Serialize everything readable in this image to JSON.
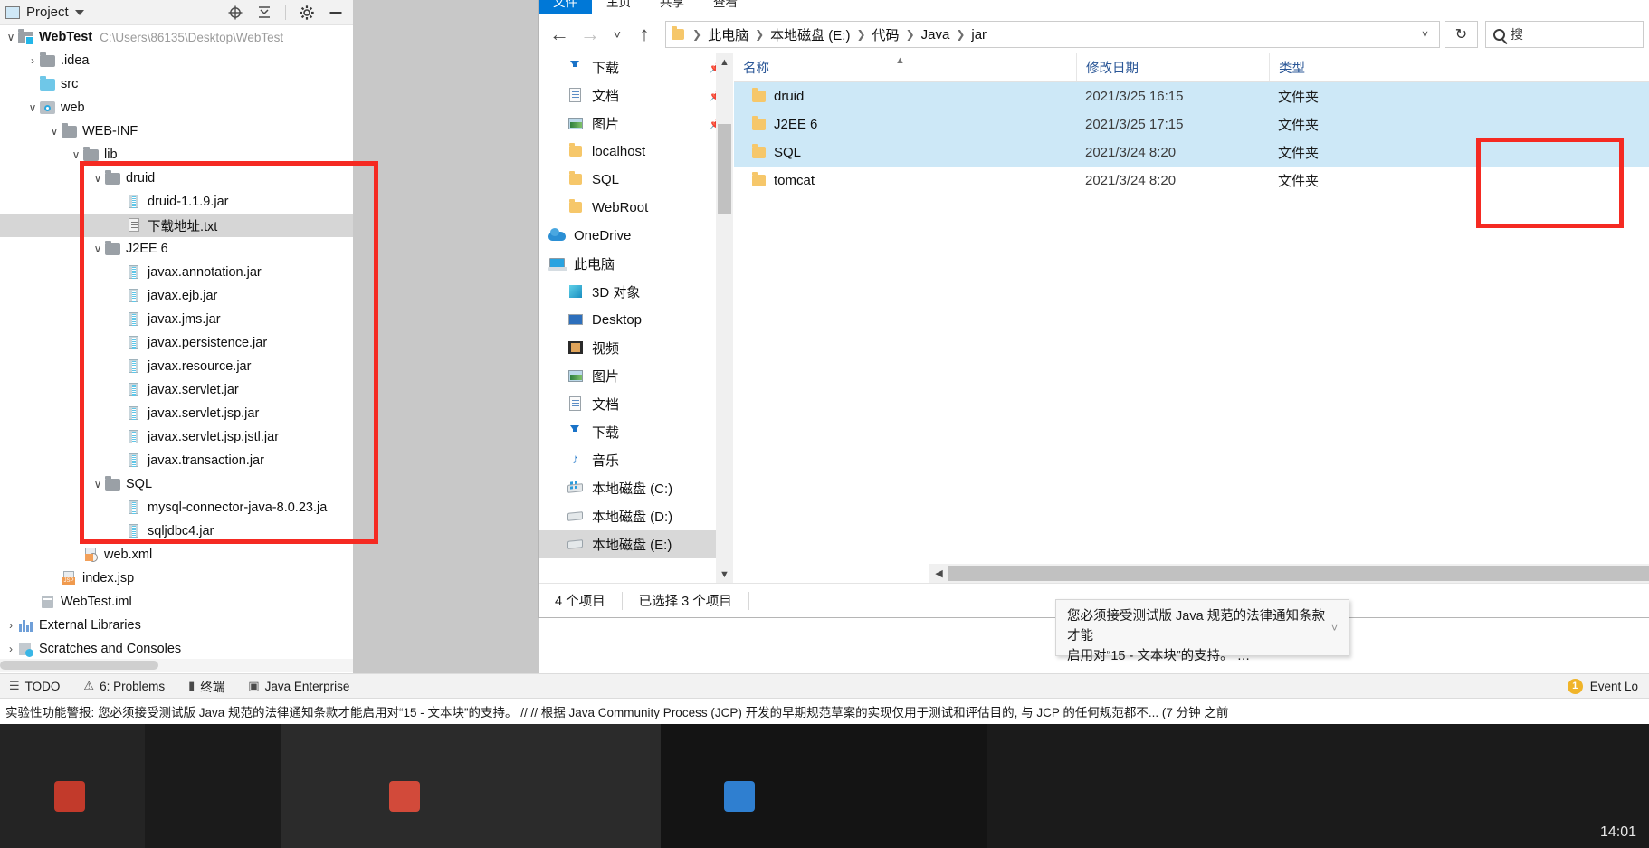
{
  "ide": {
    "toolwindow": {
      "title": "Project",
      "caret_icon": "chevron-down-icon",
      "actions": [
        "target-icon",
        "collapse-all-icon",
        "gear-icon",
        "minimize-icon"
      ]
    },
    "tree": [
      {
        "indent": 0,
        "arrow": "v",
        "icon": "module-icon",
        "label": "WebTest",
        "bold": true,
        "path": "C:\\Users\\86135\\Desktop\\WebTest"
      },
      {
        "indent": 1,
        "arrow": ">",
        "icon": "folder-icon",
        "label": ".idea"
      },
      {
        "indent": 1,
        "arrow": "",
        "icon": "folder-blue-icon",
        "label": "src"
      },
      {
        "indent": 1,
        "arrow": "v",
        "icon": "web-facet-icon",
        "label": "web"
      },
      {
        "indent": 2,
        "arrow": "v",
        "icon": "folder-icon",
        "label": "WEB-INF"
      },
      {
        "indent": 3,
        "arrow": "v",
        "icon": "folder-icon",
        "label": "lib"
      },
      {
        "indent": 4,
        "arrow": "v",
        "icon": "folder-icon",
        "label": "druid"
      },
      {
        "indent": 5,
        "arrow": "",
        "icon": "jar-icon",
        "label": "druid-1.1.9.jar"
      },
      {
        "indent": 5,
        "arrow": "",
        "icon": "txt-icon",
        "label": "下载地址.txt",
        "selected": true
      },
      {
        "indent": 4,
        "arrow": "v",
        "icon": "folder-icon",
        "label": "J2EE 6"
      },
      {
        "indent": 5,
        "arrow": "",
        "icon": "jar-icon",
        "label": "javax.annotation.jar"
      },
      {
        "indent": 5,
        "arrow": "",
        "icon": "jar-icon",
        "label": "javax.ejb.jar"
      },
      {
        "indent": 5,
        "arrow": "",
        "icon": "jar-icon",
        "label": "javax.jms.jar"
      },
      {
        "indent": 5,
        "arrow": "",
        "icon": "jar-icon",
        "label": "javax.persistence.jar"
      },
      {
        "indent": 5,
        "arrow": "",
        "icon": "jar-icon",
        "label": "javax.resource.jar"
      },
      {
        "indent": 5,
        "arrow": "",
        "icon": "jar-icon",
        "label": "javax.servlet.jar"
      },
      {
        "indent": 5,
        "arrow": "",
        "icon": "jar-icon",
        "label": "javax.servlet.jsp.jar"
      },
      {
        "indent": 5,
        "arrow": "",
        "icon": "jar-icon",
        "label": "javax.servlet.jsp.jstl.jar"
      },
      {
        "indent": 5,
        "arrow": "",
        "icon": "jar-icon",
        "label": "javax.transaction.jar"
      },
      {
        "indent": 4,
        "arrow": "v",
        "icon": "folder-icon",
        "label": "SQL"
      },
      {
        "indent": 5,
        "arrow": "",
        "icon": "jar-icon",
        "label": "mysql-connector-java-8.0.23.ja"
      },
      {
        "indent": 5,
        "arrow": "",
        "icon": "jar-icon",
        "label": "sqljdbc4.jar"
      },
      {
        "indent": 3,
        "arrow": "",
        "icon": "xml-icon",
        "label": "web.xml"
      },
      {
        "indent": 2,
        "arrow": "",
        "icon": "jsp-icon",
        "label": "index.jsp"
      },
      {
        "indent": 1,
        "arrow": "",
        "icon": "iml-icon",
        "label": "WebTest.iml"
      },
      {
        "indent": 0,
        "arrow": ">",
        "icon": "external-libraries-icon",
        "label": "External Libraries"
      },
      {
        "indent": 0,
        "arrow": ">",
        "icon": "scratches-icon",
        "label": "Scratches and Consoles"
      }
    ],
    "bottom_bar": {
      "items": [
        {
          "icon": "todo-icon",
          "label": "TODO"
        },
        {
          "icon": "problems-icon",
          "label": "6: Problems"
        },
        {
          "icon": "terminal-icon",
          "label": "终端"
        },
        {
          "icon": "java-enterprise-icon",
          "label": "Java Enterprise"
        }
      ],
      "event_log": {
        "count": "1",
        "label": "Event Lo"
      }
    },
    "status_text": "实验性功能警报: 您必须接受测试版 Java 规范的法律通知条款才能启用对“15 - 文本块”的支持。 // // 根据 Java Community Process (JCP) 开发的早期规范草案的实现仅用于测试和评估目的, 与 JCP 的任何规范都不... (7 分钟 之前"
  },
  "explorer": {
    "ribbon_tabs": [
      {
        "label": "文件",
        "active": true
      },
      {
        "label": "主页",
        "active": false
      },
      {
        "label": "共享",
        "active": false
      },
      {
        "label": "查看",
        "active": false
      }
    ],
    "nav": {
      "back_icon": "arrow-left-icon",
      "forward_icon": "arrow-right-icon",
      "recent_icon": "chevron-down-icon",
      "up_icon": "arrow-up-icon",
      "refresh_icon": "refresh-icon",
      "breadcrumbs": [
        "此电脑",
        "本地磁盘 (E:)",
        "代码",
        "Java",
        "jar"
      ],
      "address_caret_icon": "chevron-down-icon"
    },
    "search": {
      "placeholder": "搜",
      "icon": "search-icon"
    },
    "sidebar": [
      {
        "label": "下载",
        "icon": "download-icon",
        "pinned": true,
        "indent": 1
      },
      {
        "label": "文档",
        "icon": "documents-icon",
        "pinned": true,
        "indent": 1
      },
      {
        "label": "图片",
        "icon": "pictures-icon",
        "pinned": true,
        "indent": 1
      },
      {
        "label": "localhost",
        "icon": "folder-icon",
        "pinned": false,
        "indent": 1
      },
      {
        "label": "SQL",
        "icon": "folder-icon",
        "pinned": false,
        "indent": 1
      },
      {
        "label": "WebRoot",
        "icon": "folder-icon",
        "pinned": false,
        "indent": 1
      },
      {
        "label": "OneDrive",
        "icon": "onedrive-icon",
        "pinned": false,
        "indent": 0
      },
      {
        "label": "此电脑",
        "icon": "this-pc-icon",
        "pinned": false,
        "indent": 0
      },
      {
        "label": "3D 对象",
        "icon": "3d-objects-icon",
        "pinned": false,
        "indent": 1
      },
      {
        "label": "Desktop",
        "icon": "desktop-icon",
        "pinned": false,
        "indent": 1
      },
      {
        "label": "视频",
        "icon": "videos-icon",
        "pinned": false,
        "indent": 1
      },
      {
        "label": "图片",
        "icon": "pictures-icon",
        "pinned": false,
        "indent": 1
      },
      {
        "label": "文档",
        "icon": "documents-icon",
        "pinned": false,
        "indent": 1
      },
      {
        "label": "下载",
        "icon": "download-icon",
        "pinned": false,
        "indent": 1
      },
      {
        "label": "音乐",
        "icon": "music-icon",
        "pinned": false,
        "indent": 1
      },
      {
        "label": "本地磁盘 (C:)",
        "icon": "drive-windows-icon",
        "pinned": false,
        "indent": 1
      },
      {
        "label": "本地磁盘 (D:)",
        "icon": "drive-icon",
        "pinned": false,
        "indent": 1
      },
      {
        "label": "本地磁盘 (E:)",
        "icon": "drive-icon",
        "pinned": false,
        "indent": 1,
        "selected": true
      }
    ],
    "columns": {
      "name": "名称",
      "date": "修改日期",
      "type": "类型"
    },
    "files": [
      {
        "name": "druid",
        "date": "2021/3/25 16:15",
        "type": "文件夹",
        "selected": true
      },
      {
        "name": "J2EE 6",
        "date": "2021/3/25 17:15",
        "type": "文件夹",
        "selected": true
      },
      {
        "name": "SQL",
        "date": "2021/3/24 8:20",
        "type": "文件夹",
        "selected": true
      },
      {
        "name": "tomcat",
        "date": "2021/3/24 8:20",
        "type": "文件夹",
        "selected": false
      }
    ],
    "status": {
      "count": "4 个项目",
      "selection": "已选择 3 个项目"
    }
  },
  "balloon": {
    "line1": "您必须接受测试版 Java 规范的法律通知条款才能",
    "line2": "启用对“15 - 文本块”的支持。 …",
    "caret_icon": "chevron-down-icon"
  },
  "taskbar": {
    "clock_time": "14:01"
  },
  "colors": {
    "accent": "#0078d7",
    "highlight_rect": "#f52a22",
    "selection_blue": "#cde8f7",
    "folder_yellow": "#f6c76a",
    "warn_badge": "#f0b429"
  }
}
